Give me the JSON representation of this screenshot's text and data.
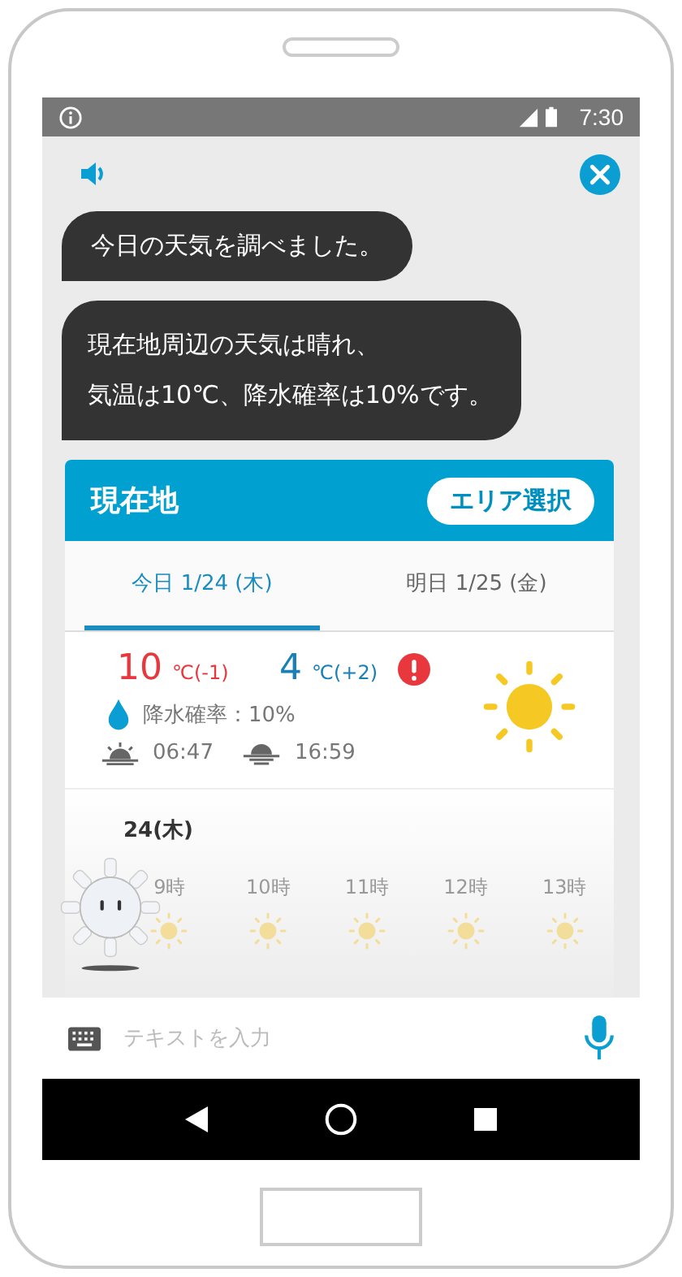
{
  "status_bar": {
    "time": "7:30"
  },
  "messages": [
    {
      "text": "今日の天気を調べました。"
    },
    {
      "lines": [
        "現在地周辺の天気は晴れ、",
        "気温は10℃、降水確率は10%です。"
      ]
    }
  ],
  "card": {
    "title": "現在地",
    "area_button": "エリア選択",
    "tabs": [
      {
        "label": "今日 1/24 (木)",
        "selected": true
      },
      {
        "label": "明日 1/25 (金)",
        "selected": false
      }
    ],
    "high": {
      "value": "10",
      "unit": "℃(-1)"
    },
    "low": {
      "value": "4",
      "unit": "℃(+2)"
    },
    "warning": true,
    "rain": "降水確率：10%",
    "sunrise": "06:47",
    "sunset": "16:59",
    "hourly_date": "24(木)",
    "hours": [
      {
        "label": "9時"
      },
      {
        "label": "10時"
      },
      {
        "label": "11時"
      },
      {
        "label": "12時"
      },
      {
        "label": "13時"
      }
    ]
  },
  "input": {
    "placeholder": "テキストを入力"
  }
}
